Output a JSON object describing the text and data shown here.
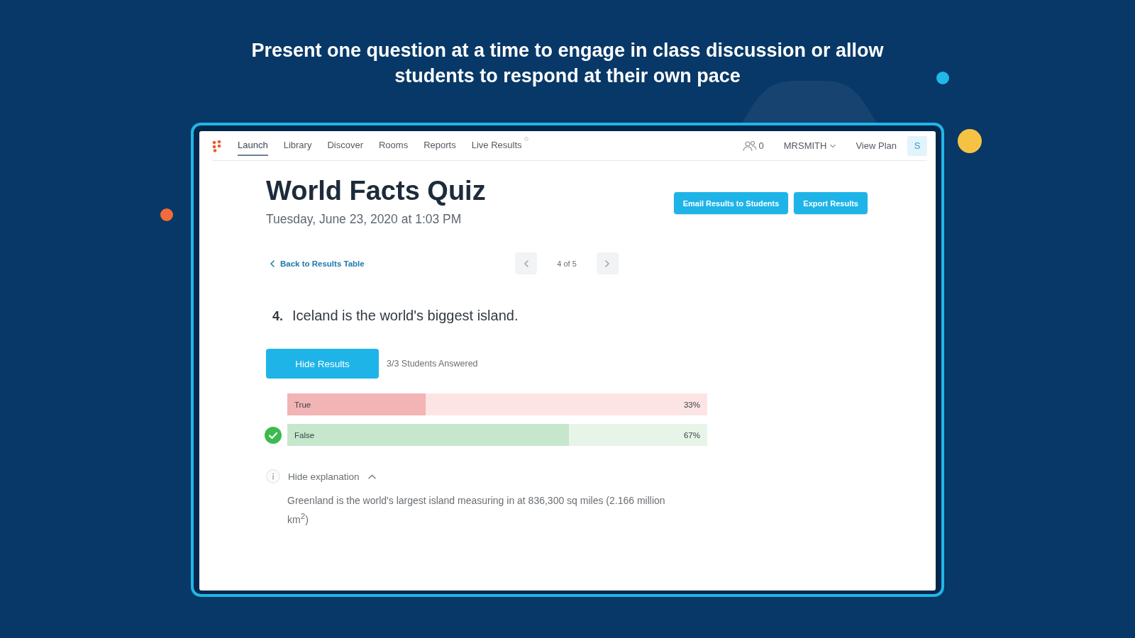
{
  "headline": "Present one question at a time to engage in class discussion or allow students to respond at their own pace",
  "app": {
    "nav": {
      "items": [
        {
          "label": "Launch",
          "selected": true
        },
        {
          "label": "Library",
          "selected": false
        },
        {
          "label": "Discover",
          "selected": false
        },
        {
          "label": "Rooms",
          "selected": false
        },
        {
          "label": "Reports",
          "selected": false
        },
        {
          "label": "Live Results",
          "selected": false
        }
      ],
      "online_count": "0",
      "user": "MRSMITH",
      "view_plan": "View Plan",
      "avatar": "S"
    },
    "quiz": {
      "title": "World Facts Quiz",
      "date": "Tuesday, June 23, 2020 at 1:03 PM",
      "actions": [
        "Email Results to Students",
        "Export Results"
      ],
      "back_link": "Back to Results Table",
      "pager": "4 of 5",
      "question": {
        "number": "4.",
        "text": "Iceland is the world's biggest island."
      },
      "results_toggle": "Hide Results",
      "answered": "3/3 Students Answered",
      "answers": [
        {
          "label": "True",
          "percent": "33%",
          "level": 0.33,
          "correct": false
        },
        {
          "label": "False",
          "percent": "67%",
          "level": 0.67,
          "correct": true
        }
      ],
      "explanation": {
        "toggle": "Hide explanation",
        "expanded": true,
        "text": "Greenland is the world's largest island measuring in at 836,300 sq miles (2.166 million km$^{2}$)"
      }
    }
  }
}
